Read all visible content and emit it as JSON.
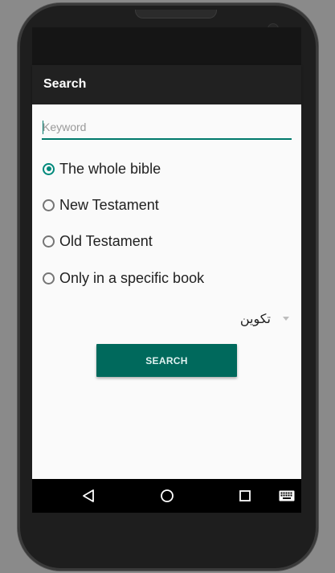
{
  "appbar": {
    "title": "Search"
  },
  "search": {
    "keyword_placeholder": "Keyword",
    "keyword_value": ""
  },
  "scope_options": [
    {
      "label": "The whole bible",
      "checked": true
    },
    {
      "label": "New Testament",
      "checked": false
    },
    {
      "label": "Old Testament",
      "checked": false
    },
    {
      "label": "Only in a specific book",
      "checked": false
    }
  ],
  "book_select": {
    "selected": "تکوین",
    "icon": "dropdown-arrow-icon"
  },
  "search_button": {
    "label": "SEARCH"
  },
  "navbar": {
    "back_icon": "back-triangle-icon",
    "home_icon": "home-circle-icon",
    "recents_icon": "recents-square-icon",
    "keyboard_icon": "keyboard-icon"
  },
  "colors": {
    "accent": "#00897b",
    "button": "#00695c",
    "appbar": "#212121",
    "background": "#fafafa"
  }
}
